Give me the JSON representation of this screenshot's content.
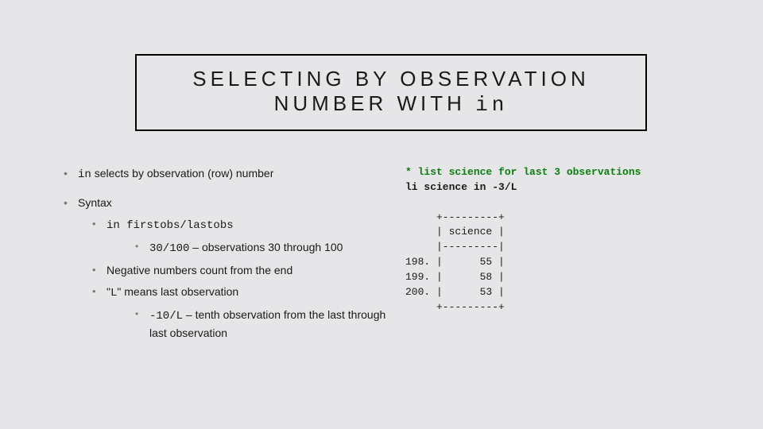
{
  "title": {
    "line1": "SELECTING BY OBSERVATION",
    "line2_a": "NUMBER WITH ",
    "line2_b": "in"
  },
  "bullets": {
    "b1a": "in",
    "b1b": " selects by observation (row) number",
    "b2": "Syntax",
    "b3a": "in firstobs/lastobs",
    "b4a": "30/100",
    "b4b": " – observations 30 through 100",
    "b5": "Negative numbers count from the end",
    "b6a": "\"",
    "b6b": "L",
    "b6c": "\" means last observation",
    "b7a": "-10/L",
    "b7b": " – tenth observation from the last through last observation"
  },
  "code": {
    "comment": "* list science for last 3 observations",
    "cmd": "li science in -3/L",
    "out1": "     +---------+",
    "out2": "     | science |",
    "out3": "     |---------|",
    "out4": "198. |      55 |",
    "out5": "199. |      58 |",
    "out6": "200. |      53 |",
    "out7": "     +---------+"
  }
}
